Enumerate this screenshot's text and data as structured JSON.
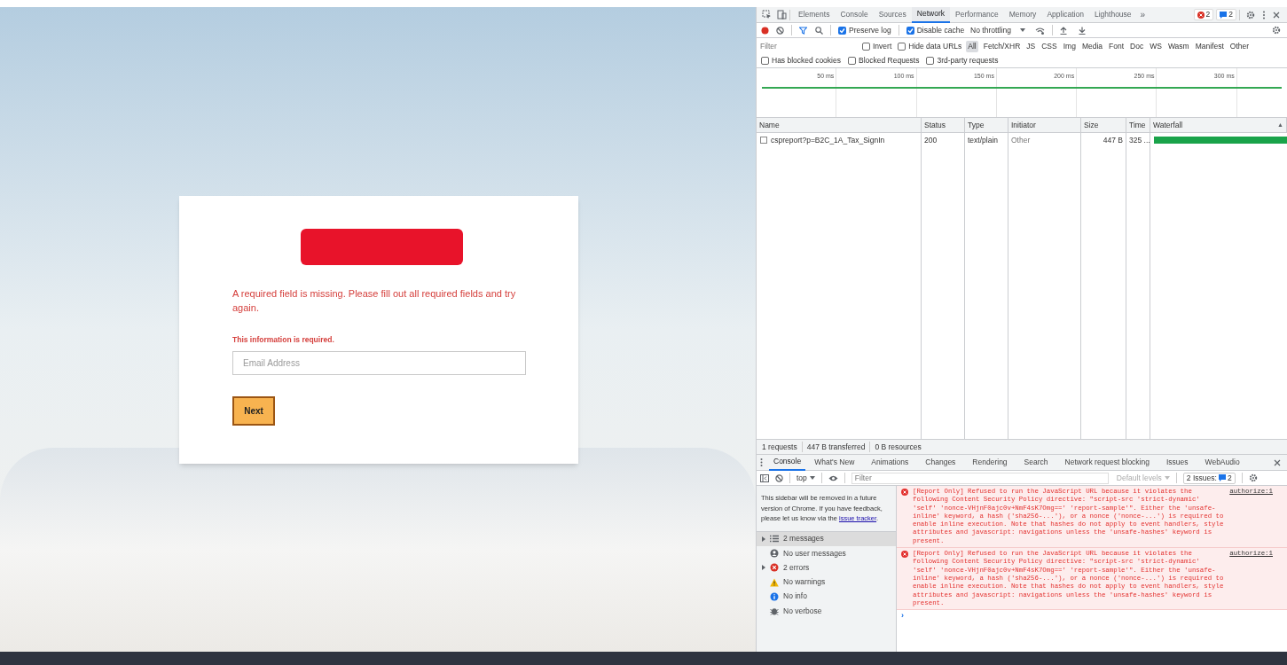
{
  "background": {
    "login_card": {
      "error_message": "A required field is missing. Please fill out all required fields and try again.",
      "field_error": "This information is required.",
      "email_field": {
        "placeholder": "Email Address"
      },
      "next_button": "Next"
    }
  },
  "devtools": {
    "panel_tabs": [
      {
        "label": "Elements",
        "selected": false
      },
      {
        "label": "Console",
        "selected": false
      },
      {
        "label": "Sources",
        "selected": false
      },
      {
        "label": "Network",
        "selected": true
      },
      {
        "label": "Performance",
        "selected": false
      },
      {
        "label": "Memory",
        "selected": false
      },
      {
        "label": "Application",
        "selected": false
      },
      {
        "label": "Lighthouse",
        "selected": false
      }
    ],
    "more_tabs": "»",
    "error_count": "2",
    "issue_count": "2",
    "network_toolbar": {
      "preserve_log": {
        "label": "Preserve log",
        "checked": true
      },
      "disable_cache": {
        "label": "Disable cache",
        "checked": true
      },
      "throttling": "No throttling"
    },
    "filter_bar": {
      "filter": {
        "placeholder": "Filter"
      },
      "options": [
        {
          "label": "Invert",
          "checked": false
        },
        {
          "label": "Hide data URLs",
          "checked": false
        }
      ],
      "type_filters": [
        {
          "label": "All",
          "selected": true
        },
        {
          "label": "Fetch/XHR",
          "selected": false
        },
        {
          "label": "JS",
          "selected": false
        },
        {
          "label": "CSS",
          "selected": false
        },
        {
          "label": "Img",
          "selected": false
        },
        {
          "label": "Media",
          "selected": false
        },
        {
          "label": "Font",
          "selected": false
        },
        {
          "label": "Doc",
          "selected": false
        },
        {
          "label": "WS",
          "selected": false
        },
        {
          "label": "Wasm",
          "selected": false
        },
        {
          "label": "Manifest",
          "selected": false
        },
        {
          "label": "Other",
          "selected": false
        }
      ]
    },
    "blocked_options": [
      {
        "label": "Has blocked cookies",
        "checked": false
      },
      {
        "label": "Blocked Requests",
        "checked": false
      },
      {
        "label": "3rd-party requests",
        "checked": false
      }
    ],
    "overview": {
      "ticks": [
        "50 ms",
        "100 ms",
        "150 ms",
        "200 ms",
        "250 ms",
        "300 ms"
      ]
    },
    "table": {
      "columns": [
        "Name",
        "Status",
        "Type",
        "Initiator",
        "Size",
        "Time",
        "Waterfall"
      ],
      "sort_indicator": "▲",
      "rows": [
        {
          "name": "cspreport?p=B2C_1A_Tax_SignIn",
          "status": "200",
          "type": "text/plain",
          "initiator": "Other",
          "size": "447 B",
          "time": "325 ..."
        }
      ]
    },
    "summary": [
      "1 requests",
      "447 B transferred",
      "0 B resources"
    ],
    "drawer_tabs": [
      {
        "label": "Console",
        "selected": true
      },
      {
        "label": "What's New",
        "selected": false
      },
      {
        "label": "Animations",
        "selected": false
      },
      {
        "label": "Changes",
        "selected": false
      },
      {
        "label": "Rendering",
        "selected": false
      },
      {
        "label": "Search",
        "selected": false
      },
      {
        "label": "Network request blocking",
        "selected": false
      },
      {
        "label": "Issues",
        "selected": false
      },
      {
        "label": "WebAudio",
        "selected": false
      }
    ],
    "console_toolbar": {
      "context": "top",
      "filter": {
        "placeholder": "Filter"
      },
      "levels": "Default levels",
      "issues_label": "2 Issues:",
      "issues_count": "2"
    },
    "console_sidebar": {
      "notice": {
        "text": "This sidebar will be removed in a future version of Chrome. If you have feedback, please let us know via the",
        "link": "issue tracker",
        "end": "."
      },
      "items": [
        {
          "kind": "messages",
          "label": "2 messages",
          "expandable": true,
          "selected": true
        },
        {
          "kind": "user",
          "label": "No user messages",
          "expandable": false,
          "selected": false
        },
        {
          "kind": "errors",
          "label": "2 errors",
          "expandable": true,
          "selected": false
        },
        {
          "kind": "warnings",
          "label": "No warnings",
          "expandable": false,
          "selected": false
        },
        {
          "kind": "info",
          "label": "No info",
          "expandable": false,
          "selected": false
        },
        {
          "kind": "verbose",
          "label": "No verbose",
          "expandable": false,
          "selected": false
        }
      ]
    },
    "messages": [
      {
        "text": "[Report Only] Refused to run the JavaScript URL because it violates the following Content Security Policy directive: \"script-src 'strict-dynamic' 'self' 'nonce-VHjnF0ajc0v+NmF4sK7Omg==' 'report-sample'\". Either the 'unsafe-inline' keyword, a hash ('sha256-...'), or a nonce ('nonce-...') is required to enable inline execution. Note that hashes do not apply to event handlers, style attributes and javascript: navigations unless the 'unsafe-hashes' keyword is present.",
        "source": "authorize:1"
      },
      {
        "text": "[Report Only] Refused to run the JavaScript URL because it violates the following Content Security Policy directive: \"script-src 'strict-dynamic' 'self' 'nonce-VHjnF0ajc0v+NmF4sK7Omg==' 'report-sample'\". Either the 'unsafe-inline' keyword, a hash ('sha256-...'), or a nonce ('nonce-...') is required to enable inline execution. Note that hashes do not apply to event handlers, style attributes and javascript: navigations unless the 'unsafe-hashes' keyword is present.",
        "source": "authorize:1"
      }
    ],
    "prompt": "›"
  }
}
